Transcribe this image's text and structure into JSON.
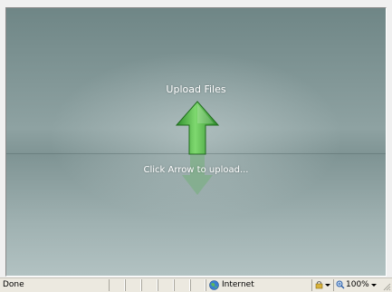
{
  "stage": {
    "title": "Upload Files",
    "hint": "Click Arrow to upload..."
  },
  "statusbar": {
    "status": "Done",
    "zone": "Internet",
    "zoom": "100%"
  },
  "icons": {
    "upload": "up-arrow-icon",
    "zone": "globe-icon",
    "protected": "lock-icon",
    "zoom": "magnifier-icon",
    "grip": "resize-grip-icon"
  },
  "colors": {
    "arrow": "#3fae3a",
    "background": "#8ea2a2"
  }
}
